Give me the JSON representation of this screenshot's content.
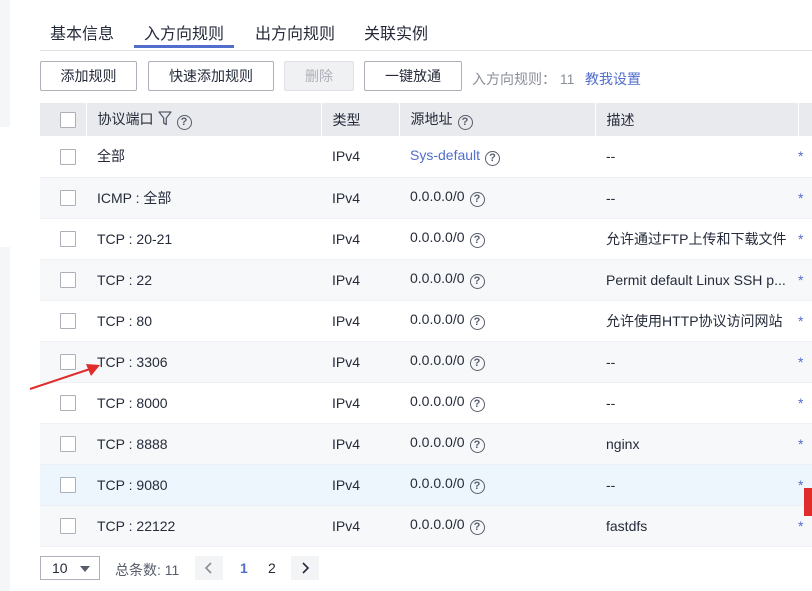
{
  "tabs": [
    {
      "label": "基本信息",
      "active": false
    },
    {
      "label": "入方向规则",
      "active": true
    },
    {
      "label": "出方向规则",
      "active": false
    },
    {
      "label": "关联实例",
      "active": false
    }
  ],
  "toolbar": {
    "add_rule": "添加规则",
    "quick_add_rule": "快速添加规则",
    "delete": "删除",
    "one_click_allow": "一键放通",
    "inbound_rules_label": "入方向规则：",
    "inbound_rules_count": "11",
    "tutorial_link": "教我设置"
  },
  "table": {
    "columns": [
      "协议端口",
      "类型",
      "源地址",
      "描述"
    ],
    "rows": [
      {
        "port": "全部",
        "type": "IPv4",
        "source": "Sys-default",
        "source_is_link": true,
        "desc": "--"
      },
      {
        "port": "ICMP : 全部",
        "type": "IPv4",
        "source": "0.0.0.0/0",
        "source_is_link": false,
        "desc": "--"
      },
      {
        "port": "TCP : 20-21",
        "type": "IPv4",
        "source": "0.0.0.0/0",
        "source_is_link": false,
        "desc": "允许通过FTP上传和下载文件"
      },
      {
        "port": "TCP : 22",
        "type": "IPv4",
        "source": "0.0.0.0/0",
        "source_is_link": false,
        "desc": "Permit default Linux SSH p..."
      },
      {
        "port": "TCP : 80",
        "type": "IPv4",
        "source": "0.0.0.0/0",
        "source_is_link": false,
        "desc": "允许使用HTTP协议访问网站"
      },
      {
        "port": "TCP : 3306",
        "type": "IPv4",
        "source": "0.0.0.0/0",
        "source_is_link": false,
        "desc": "--"
      },
      {
        "port": "TCP : 8000",
        "type": "IPv4",
        "source": "0.0.0.0/0",
        "source_is_link": false,
        "desc": "--"
      },
      {
        "port": "TCP : 8888",
        "type": "IPv4",
        "source": "0.0.0.0/0",
        "source_is_link": false,
        "desc": "nginx"
      },
      {
        "port": "TCP : 9080",
        "type": "IPv4",
        "source": "0.0.0.0/0",
        "source_is_link": false,
        "desc": "--",
        "hover": true
      },
      {
        "port": "TCP : 22122",
        "type": "IPv4",
        "source": "0.0.0.0/0",
        "source_is_link": false,
        "desc": "fastdfs"
      }
    ]
  },
  "pagination": {
    "page_size": "10",
    "total_label": "总条数: 11",
    "pages": [
      "1",
      "2"
    ],
    "current_page": "1"
  },
  "icons": {
    "filter": "funnel-icon",
    "help": "question-circle-icon",
    "prev": "chevron-left-icon",
    "next": "chevron-right-icon",
    "dropdown": "caret-down-icon",
    "annotation": "red-arrow-icon"
  },
  "colors": {
    "accent": "#526ecc",
    "header_bg": "#e9eaed",
    "hover_row": "#eef6fd",
    "annotation_red": "#e02c2c"
  }
}
